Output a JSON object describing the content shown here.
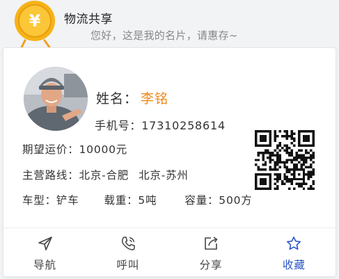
{
  "header": {
    "app_title": "物流共享",
    "greeting": "您好，这是我的名片，请惠存~"
  },
  "card": {
    "name_label": "姓名：",
    "name_value": "李铭",
    "phone": "手机号：17310258614",
    "expected_freight": "期望运价：10000元",
    "route_label": "主营路线：",
    "route_1": "北京-合肥",
    "route_2": "北京-苏州",
    "vehicle_type": "车型：铲车",
    "load_weight": "载重：5吨",
    "capacity": "容量：500方"
  },
  "actions": [
    {
      "label": "导航",
      "icon": "send-icon"
    },
    {
      "label": "呼叫",
      "icon": "phone-icon"
    },
    {
      "label": "分享",
      "icon": "share-icon"
    },
    {
      "label": "收藏",
      "icon": "star-icon"
    }
  ],
  "colors": {
    "name_accent": "#f08a1c",
    "favorite_accent": "#2b56c6",
    "coin": "#f6b316"
  }
}
